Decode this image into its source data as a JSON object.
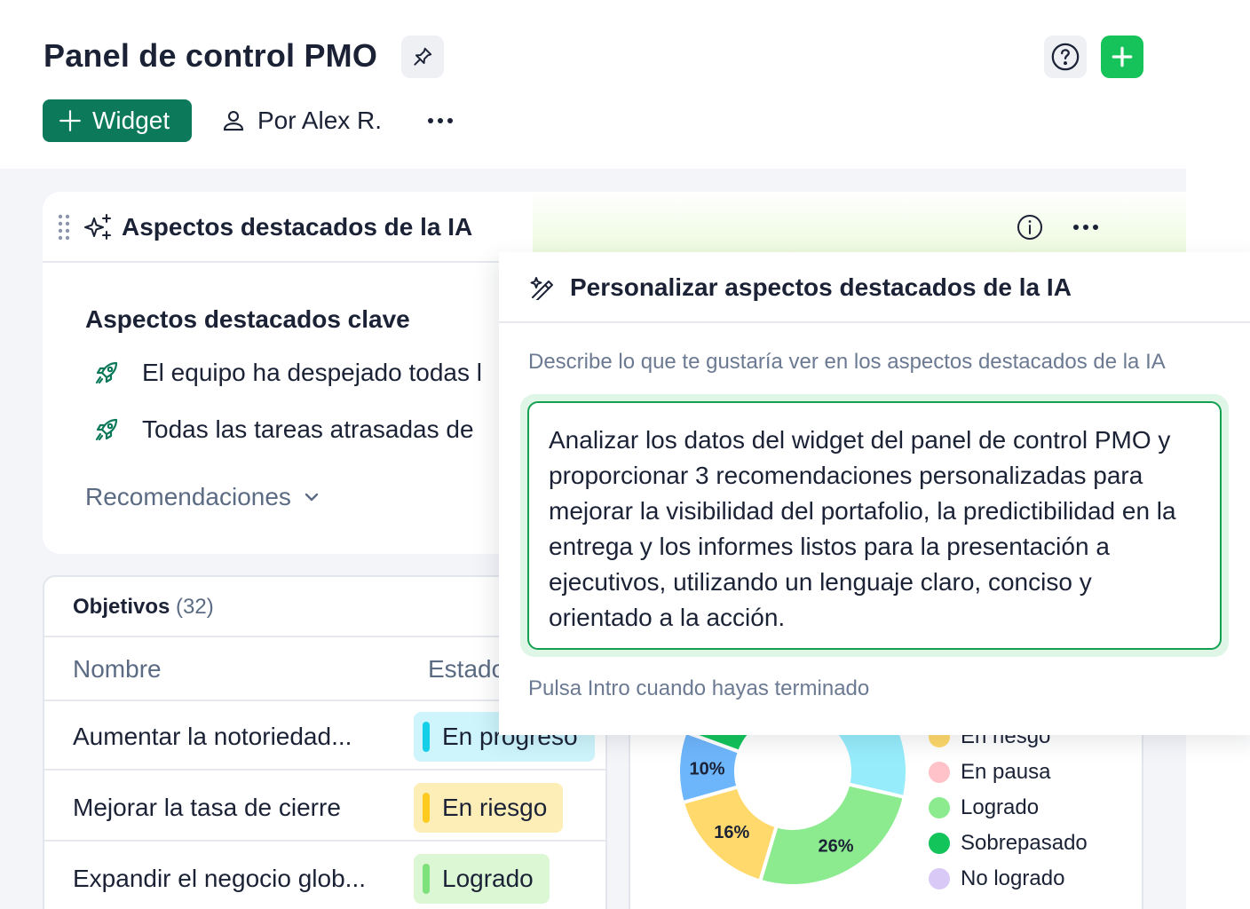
{
  "header": {
    "title": "Panel de control PMO",
    "widget_button": "Widget",
    "owner": "Por Alex R."
  },
  "ai_card": {
    "title": "Aspectos destacados de la IA",
    "key_heading": "Aspectos destacados clave",
    "highlights": [
      "El equipo ha despejado todas l",
      "Todas las tareas atrasadas de"
    ],
    "recommendations": "Recomendaciones"
  },
  "objectives": {
    "title": "Objetivos",
    "count": "(32)",
    "columns": [
      "Nombre",
      "Estado"
    ],
    "rows": [
      {
        "name": "Aumentar la notoriedad...",
        "status": "En progreso",
        "status_color": "#cdf5fb",
        "bar_color": "#15cfe9"
      },
      {
        "name": "Mejorar la tasa de cierre",
        "status": "En riesgo",
        "status_color": "#fdeeb8",
        "bar_color": "#ffca20"
      },
      {
        "name": "Expandir el negocio glob...",
        "status": "Logrado",
        "status_color": "#dcf7d4",
        "bar_color": "#7fe179"
      }
    ]
  },
  "chart_data": {
    "type": "pie",
    "variant": "donut",
    "slices": [
      {
        "label": "10%",
        "value": 10,
        "color": "#6eb6fb"
      },
      {
        "label": "16%",
        "value": 16,
        "color": "#ffd96b"
      },
      {
        "label": "26%",
        "value": 26,
        "color": "#8ceb8f"
      }
    ],
    "legend": [
      {
        "name": "En riesgo",
        "color": "#ffd96b"
      },
      {
        "name": "En pausa",
        "color": "#ffc2c8"
      },
      {
        "name": "Logrado",
        "color": "#8ceb8f"
      },
      {
        "name": "Sobrepasado",
        "color": "#12c45a"
      },
      {
        "name": "No logrado",
        "color": "#d8c9f7"
      }
    ]
  },
  "popover": {
    "title": "Personalizar aspectos destacados de la IA",
    "label": "Describe lo que te gustaría ver en los aspectos destacados de la IA",
    "prompt": "Analizar los datos del widget del panel de control PMO y proporcionar 3 recomendaciones personalizadas para mejorar la visibilidad del portafolio, la predictibilidad en la entrega y los informes listos para la presentación a ejecutivos, utilizando un lenguaje claro, conciso y orientado a la acción.",
    "hint": "Pulsa Intro cuando hayas terminado"
  },
  "colors": {
    "brand_green": "#16c25a",
    "widget_button": "#0c7a5a",
    "prompt_border": "#12a150"
  }
}
